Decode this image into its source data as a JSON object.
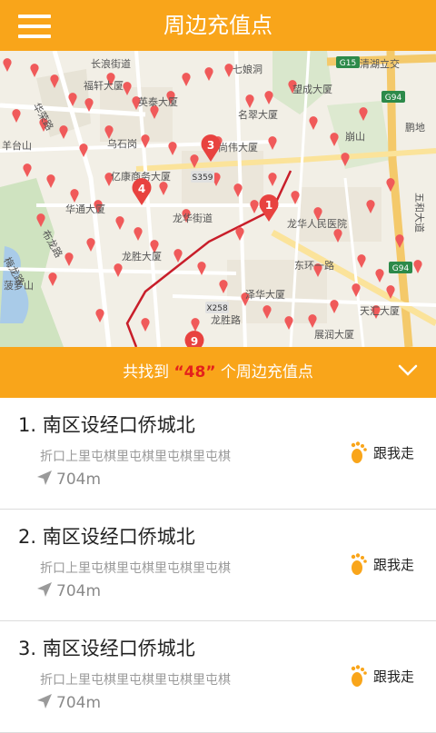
{
  "header": {
    "title": "周边充值点",
    "menu_icon": "hamburger-menu-icon"
  },
  "map": {
    "labels": [
      "长浪街道",
      "福轩大厦",
      "英泰大厦",
      "七娘洞",
      "望成大厦",
      "名翠大厦",
      "清湖立交",
      "鹏地",
      "崩山",
      "乌石岗",
      "亿康商务大厦",
      "华通大厦",
      "龙华街道",
      "龙华人民医院",
      "龙胜大厦",
      "泽华大厦",
      "天汇大厦",
      "展润大厦",
      "五和大道",
      "华荣路",
      "布龙路",
      "梅龙路",
      "东环一路",
      "龙胜路",
      "羊台山",
      "菠萝山",
      "尚伟大厦"
    ],
    "road_badges": [
      "G15",
      "G94",
      "G94",
      "S359",
      "X258"
    ],
    "cluster_numbers": [
      "1",
      "3",
      "4",
      "9"
    ],
    "pin_color": "#f05a5a",
    "route_color": "#c81e2a"
  },
  "summary": {
    "prefix": "共找到 ",
    "count": "“48”",
    "suffix": " 个周边充值点",
    "toggle_icon": "chevron-down-icon"
  },
  "items": [
    {
      "title": "1. 南区设经口侨城北",
      "address": "折口上里屯棋里屯棋里屯棋里屯棋",
      "distance": "704m",
      "follow_label": "跟我走"
    },
    {
      "title": "2. 南区设经口侨城北",
      "address": "折口上里屯棋里屯棋里屯棋里屯棋",
      "distance": "704m",
      "follow_label": "跟我走"
    },
    {
      "title": "3. 南区设经口侨城北",
      "address": "折口上里屯棋里屯棋里屯棋里屯棋",
      "distance": "704m",
      "follow_label": "跟我走"
    }
  ],
  "colors": {
    "accent": "#f9a51a",
    "highlight": "#e4211c"
  }
}
